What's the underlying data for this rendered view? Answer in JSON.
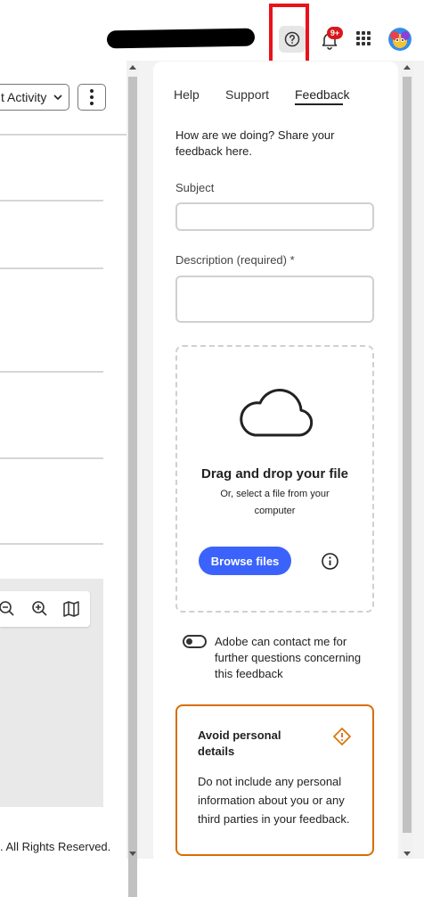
{
  "header": {
    "help_icon": "question-circle-icon",
    "notification_icon": "bell-icon",
    "notification_badge": "9+",
    "apps_icon": "apps-grid-icon",
    "avatar_icon": "user-avatar"
  },
  "left": {
    "activity_select_value": "t Activity",
    "more_icon": "more-vertical-icon",
    "map_tools": [
      "zoom-out-icon",
      "zoom-in-icon",
      "map-icon"
    ],
    "footer": ". All Rights Reserved."
  },
  "panel": {
    "tabs": [
      {
        "label": "Help",
        "active": false
      },
      {
        "label": "Support",
        "active": false
      },
      {
        "label": "Feedback",
        "active": true
      }
    ],
    "intro": "How are we doing? Share your feedback here.",
    "subject_label": "Subject",
    "subject_value": "",
    "description_label": "Description (required) *",
    "description_value": "",
    "upload": {
      "title": "Drag and drop your file",
      "subtitle": "Or, select a file from your computer",
      "button": "Browse files"
    },
    "contact_toggle": {
      "label": "Adobe can contact me for further questions concerning this feedback",
      "on": false
    },
    "warning": {
      "title": "Avoid personal details",
      "body": "Do not include any personal information about you or any third parties in your feedback."
    }
  },
  "colors": {
    "accent": "#3b63fb",
    "highlight": "#e8121b",
    "warning": "#d86e00",
    "badge": "#d7191c"
  }
}
